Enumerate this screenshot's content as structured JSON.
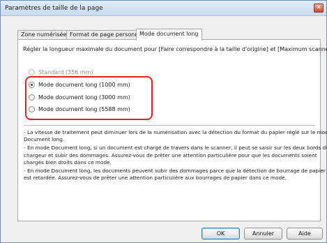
{
  "window": {
    "title": "Paramètres de taille de la page",
    "close_glyph": "✕"
  },
  "tabs": [
    {
      "label": "Zone numérisée"
    },
    {
      "label": "Format de page personnalisé"
    },
    {
      "label": "Mode document long"
    }
  ],
  "panel": {
    "description": "Régler la longueur maximale du document pour [Faire correspondre à la taille d'origine] et [Maximum scanner].",
    "options": [
      {
        "label": "Standard (356 mm)",
        "checked": false,
        "disabled": true
      },
      {
        "label": "Mode document long (1000 mm)",
        "checked": true,
        "disabled": false
      },
      {
        "label": "Mode document long (3000 mm)",
        "checked": false,
        "disabled": false
      },
      {
        "label": "Mode document long (5588 mm)",
        "checked": false,
        "disabled": false
      }
    ],
    "notes": [
      "- La vitesse de traitement peut diminuer lors de la numérisation avec la détection du format du papier réglé sur le mode",
      "Document long.",
      "- En mode Document long, si un document est chargé de travers dans le scanner, il peut se saisir sur les deux bords du",
      "chargeur et subir des dommages. Assurez-vous de prêter une attention particulière pour que les documents soient",
      "chargés bien droits dans ce mode.",
      "- En mode Document long, les documents peuvent subir des dommages parce que la détection de bourrage de papier",
      "est retardée. Assurez-vous de prêter une attention particulière aux bourrages de papier dans ce mode."
    ]
  },
  "buttons": {
    "ok": "OK",
    "cancel": "Annuler",
    "help": "Aide"
  },
  "colors": {
    "highlight": "#e02020",
    "title_bar": "#c9dbef",
    "close": "#c84a2e"
  }
}
